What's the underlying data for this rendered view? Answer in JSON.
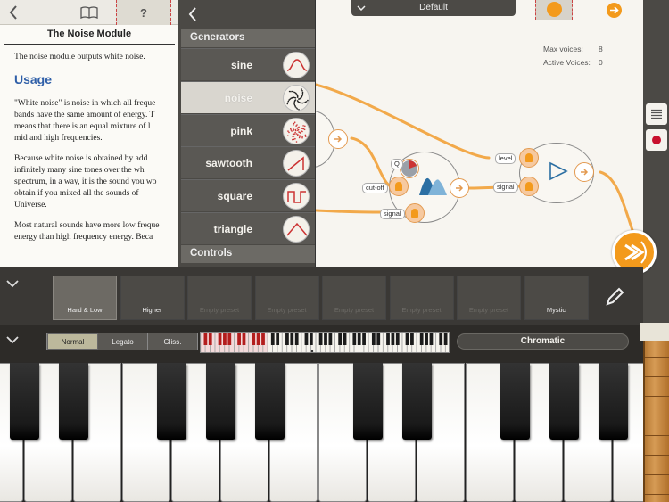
{
  "help": {
    "title": "The Noise Module",
    "intro": "The noise module outputs white noise.",
    "heading": "Usage",
    "paragraphs": [
      [
        "\"White noise\" is noise in which all freque",
        "bands have the same amount of energy. T",
        "means that there is an equal mixture of l",
        "mid and high frequencies."
      ],
      [
        "Because white noise is obtained by add",
        "infinitely many sine tones over the wh",
        "spectrum, in a way, it is the sound you wo",
        "obtain if you mixed all the sounds of",
        "Universe."
      ],
      [
        "Most natural sounds have more low freque",
        "energy than high frequency energy. Beca"
      ]
    ],
    "help_button": "?"
  },
  "generators": {
    "section_label": "Generators",
    "controls_label": "Controls",
    "items": [
      {
        "label": "sine",
        "icon": "sine-wave-icon"
      },
      {
        "label": "noise",
        "icon": "noise-icon"
      },
      {
        "label": "pink",
        "icon": "pink-noise-icon"
      },
      {
        "label": "sawtooth",
        "icon": "sawtooth-wave-icon"
      },
      {
        "label": "square",
        "icon": "square-wave-icon"
      },
      {
        "label": "triangle",
        "icon": "triangle-wave-icon"
      }
    ],
    "selected": "noise"
  },
  "patch": {
    "preset_name": "Default",
    "max_voices_label": "Max voices:",
    "max_voices": "8",
    "active_voices_label": "Active Voices:",
    "active_voices": "0",
    "port_labels": {
      "q": "Q",
      "cutoff": "cut-off",
      "signal_in": "signal",
      "level": "level",
      "signal_out": "signal"
    }
  },
  "presets": [
    {
      "label": "Hard & Low",
      "selected": true
    },
    {
      "label": "Higher"
    },
    {
      "label": "Empty preset",
      "empty": true
    },
    {
      "label": "Empty preset",
      "empty": true
    },
    {
      "label": "Empty preset",
      "empty": true
    },
    {
      "label": "Empty preset",
      "empty": true
    },
    {
      "label": "Empty preset",
      "empty": true
    },
    {
      "label": "Mystic"
    }
  ],
  "keyboard": {
    "modes": [
      "Normal",
      "Legato",
      "Gliss."
    ],
    "active_mode": "Normal",
    "scale": "Chromatic"
  },
  "colors": {
    "accent": "#f39a1c",
    "cable": "#f2a94a",
    "panel_dark": "#4b4945",
    "heading_blue": "#2f5fa8"
  }
}
